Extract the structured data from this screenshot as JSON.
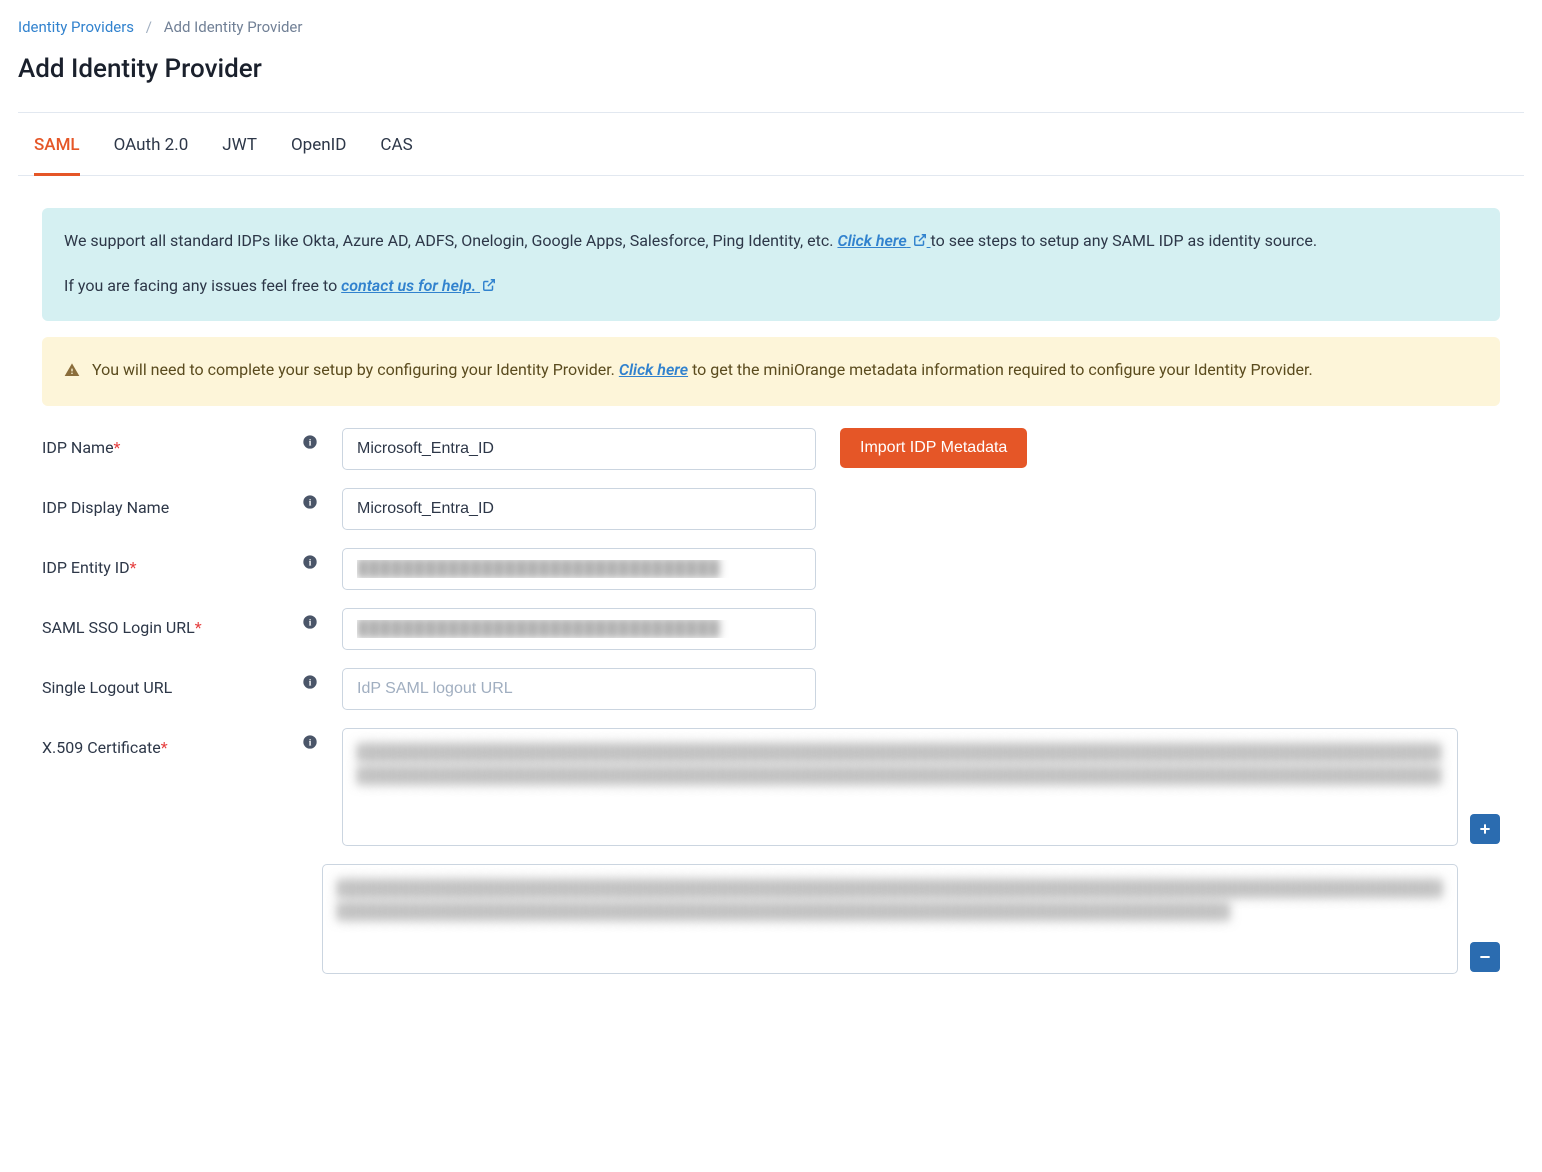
{
  "breadcrumb": {
    "parent": "Identity Providers",
    "current": "Add Identity Provider"
  },
  "page_title": "Add Identity Provider",
  "tabs": [
    {
      "label": "SAML",
      "active": true
    },
    {
      "label": "OAuth 2.0",
      "active": false
    },
    {
      "label": "JWT",
      "active": false
    },
    {
      "label": "OpenID",
      "active": false
    },
    {
      "label": "CAS",
      "active": false
    }
  ],
  "info_banner": {
    "line1_pre": "We support all standard IDPs like Okta, Azure AD, ADFS, Onelogin, Google Apps, Salesforce, Ping Identity, etc. ",
    "line1_link": "Click here",
    "line1_post": " to see steps to setup any SAML IDP as identity source.",
    "line2_pre": "If you are facing any issues feel free to ",
    "line2_link": "contact us for help."
  },
  "warn_banner": {
    "pre": "You will need to complete your setup by configuring your Identity Provider. ",
    "link": "Click here",
    "post": " to get the miniOrange metadata information required to configure your Identity Provider."
  },
  "form": {
    "idp_name": {
      "label": "IDP Name",
      "value": "Microsoft_Entra_ID"
    },
    "idp_display_name": {
      "label": "IDP Display Name",
      "value": "Microsoft_Entra_ID"
    },
    "idp_entity_id": {
      "label": "IDP Entity ID",
      "value": "████████████████████████████████"
    },
    "saml_sso_login_url": {
      "label": "SAML SSO Login URL",
      "value": "████████████████████████████████"
    },
    "single_logout_url": {
      "label": "Single Logout URL",
      "value": "",
      "placeholder": "IdP SAML logout URL"
    },
    "x509_cert": {
      "label": "X.509 Certificate"
    },
    "import_btn": "Import IDP Metadata"
  },
  "cert_blocks": [
    "████████████████████████████████████████████████████████████████████████████████████████████████████████████████████████████████████████████████████████████████████████████████████████████████████████████",
    "████████████████████████████████████████████████████████████████████████████████████████████████████████████████████████████████████████████████████████████████████████████████████████████"
  ]
}
